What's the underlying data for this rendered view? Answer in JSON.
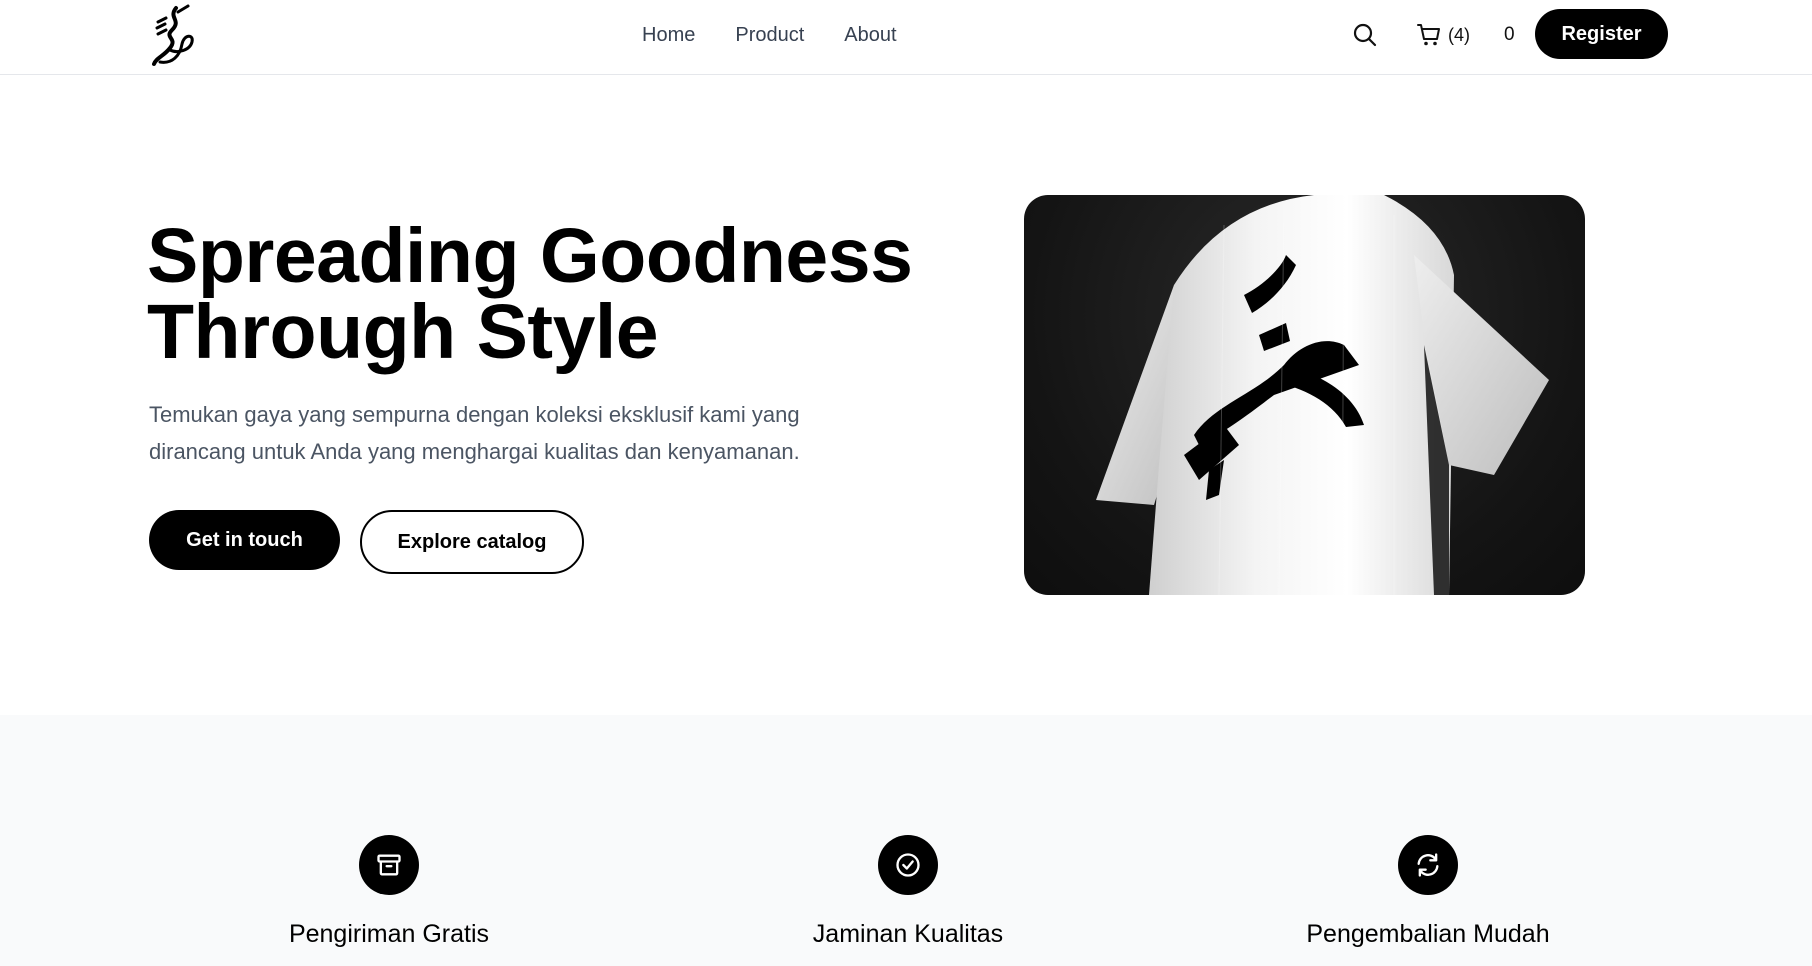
{
  "nav": {
    "logo_icon": "calligraphy-logo",
    "links": [
      "Home",
      "Product",
      "About"
    ],
    "search_icon": "search-icon",
    "cart_icon": "shopping-cart-icon",
    "cart_count": "(4)",
    "secondary_count": "0",
    "register_label": "Register"
  },
  "hero": {
    "title_line1": "Spreading Goodness",
    "title_line2": "Through Style",
    "subtitle_line1": "Temukan gaya yang sempurna dengan koleksi eksklusif kami yang",
    "subtitle_line2": "dirancang untuk Anda yang menghargai kualitas dan kenyamanan.",
    "primary_cta": "Get in touch",
    "secondary_cta": "Explore catalog",
    "image": "white t-shirt with black arabic calligraphy on dark background"
  },
  "features": [
    {
      "icon": "archive-box-icon",
      "title": "Pengiriman Gratis"
    },
    {
      "icon": "check-circle-icon",
      "title": "Jaminan Kualitas"
    },
    {
      "icon": "refresh-icon",
      "title": "Pengembalian Mudah"
    }
  ],
  "colors": {
    "primary": "#000000",
    "background": "#ffffff",
    "muted_text": "#4b5563",
    "features_bg": "#f9fafb"
  }
}
